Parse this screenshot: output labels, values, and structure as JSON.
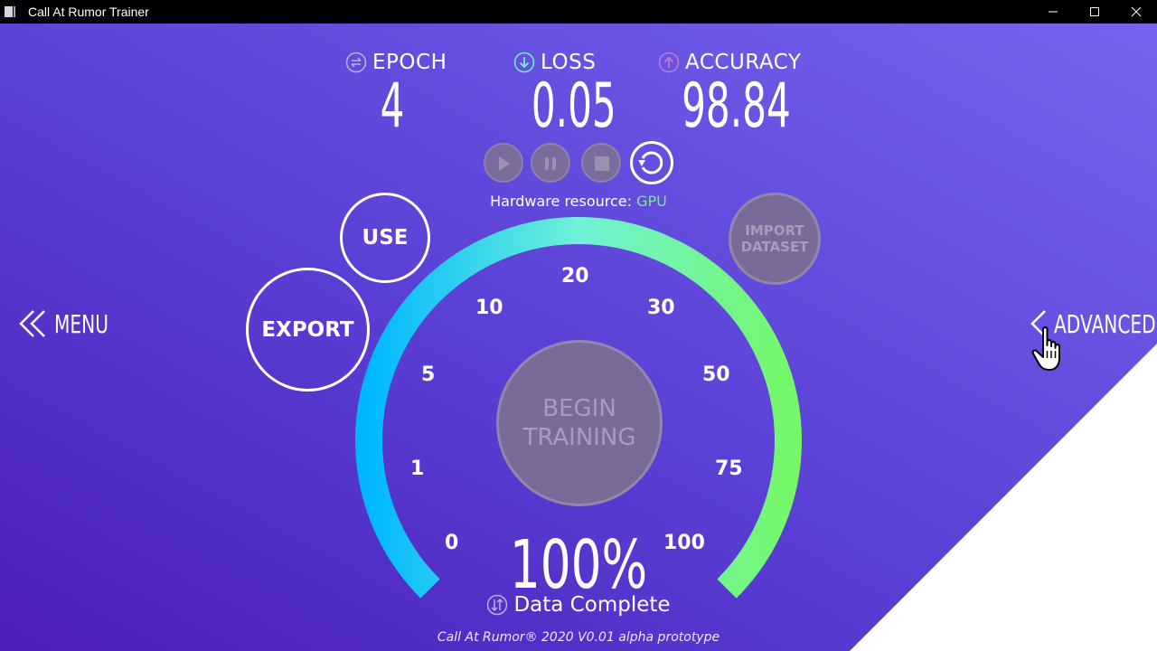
{
  "window": {
    "title": "Call At Rumor Trainer"
  },
  "stats": [
    {
      "label": "EPOCH",
      "value": "4",
      "icon": "epoch-icon"
    },
    {
      "label": "LOSS",
      "value": "0.05",
      "icon": "loss-down-icon"
    },
    {
      "label": "ACCURACY",
      "value": "98.84",
      "icon": "accuracy-up-icon"
    }
  ],
  "controls": {
    "play": "play-icon",
    "pause": "pause-icon",
    "stop": "stop-icon",
    "reset": "reset-icon"
  },
  "hardware": {
    "label": "Hardware resource: ",
    "value": "GPU"
  },
  "buttons": {
    "use": "USE",
    "export": "EXPORT",
    "import_line1": "IMPORT",
    "import_line2": "DATASET",
    "begin_line1": "BEGIN",
    "begin_line2": "TRAINING"
  },
  "nav": {
    "menu": "MENU",
    "advanced": "ADVANCED"
  },
  "gauge": {
    "ticks": [
      "0",
      "1",
      "5",
      "10",
      "20",
      "30",
      "50",
      "75",
      "100"
    ],
    "percent": "100%",
    "progress": 1.0,
    "status": "Data Complete"
  },
  "footer": "Call At Rumor® 2020 V0.01 alpha prototype",
  "colors": {
    "gauge_start": "#00b7ff",
    "gauge_mid": "#6ff2d8",
    "gauge_end": "#74f86a",
    "gpu": "#7de3a0"
  }
}
